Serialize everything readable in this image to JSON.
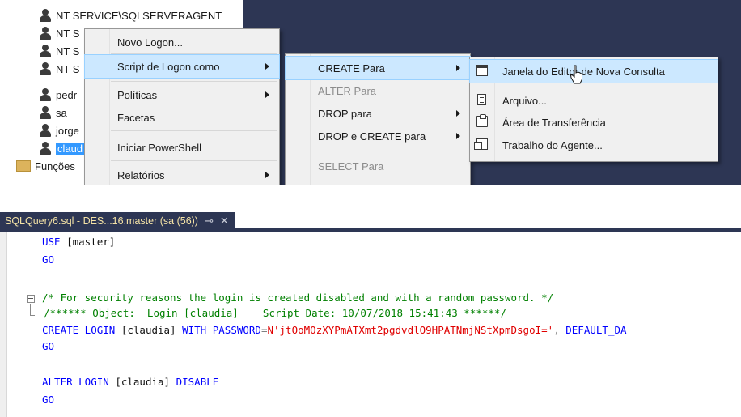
{
  "object_explorer": {
    "items": [
      {
        "label": "NT SERVICE\\SQLSERVERAGENT"
      },
      {
        "label": "NT S"
      },
      {
        "label": "NT S"
      },
      {
        "label": "NT S"
      },
      {
        "label": "pedr"
      },
      {
        "label": "sa"
      },
      {
        "label": "jorge"
      },
      {
        "label": "claud"
      },
      {
        "label": "Funções"
      }
    ]
  },
  "context_menu": {
    "items": [
      {
        "label": "Novo Logon..."
      },
      {
        "label": "Script de Logon como"
      },
      {
        "label": "Políticas"
      },
      {
        "label": "Facetas"
      },
      {
        "label": "Iniciar PowerShell"
      },
      {
        "label": "Relatórios"
      }
    ]
  },
  "script_submenu": {
    "items": [
      {
        "label": "CREATE Para"
      },
      {
        "label": "ALTER Para"
      },
      {
        "label": "DROP para"
      },
      {
        "label": "DROP e CREATE para"
      },
      {
        "label": "SELECT Para"
      }
    ]
  },
  "create_submenu": {
    "items": [
      {
        "label": "Janela do Editor de Nova Consulta",
        "icon": "new-query-window-icon"
      },
      {
        "label": "Arquivo...",
        "icon": "file-icon"
      },
      {
        "label": "Área de Transferência",
        "icon": "clipboard-icon"
      },
      {
        "label": "Trabalho do Agente...",
        "icon": "agent-job-icon"
      }
    ]
  },
  "editor": {
    "tab_title": "SQLQuery6.sql - DES...16.master (sa (56))",
    "pin_glyph": "⊸",
    "close_glyph": "✕",
    "code": {
      "l1_kw": "USE",
      "l1_rest": " [master]",
      "l2": "GO",
      "l3": "/* For security reasons the login is created disabled and with a random password. */",
      "l4": "/****** Object:  Login [claudia]    Script Date: 10/07/2018 15:41:43 ******/",
      "l5_kw1": "CREATE LOGIN",
      "l5_plain1": " [claudia] ",
      "l5_kw2": "WITH PASSWORD",
      "l5_gray": "=",
      "l5_str": "N'jtOoMOzXYPmATXmt2pgdvdlO9HPATNmjNStXpmDsgoI='",
      "l5_gray2": ",",
      "l5_kw3": " DEFAULT_DA",
      "l6": "GO",
      "l7_kw": "ALTER LOGIN",
      "l7_plain": " [claudia] ",
      "l7_kw2": "DISABLE",
      "l8": "GO"
    }
  },
  "colors": {
    "ide_dark": "#2d3654",
    "menu_bg": "#f0f0f0",
    "menu_highlight": "#cce8ff",
    "keyword": "#0000ff",
    "comment": "#008000",
    "string": "#e00000",
    "selection": "#3399ff"
  }
}
